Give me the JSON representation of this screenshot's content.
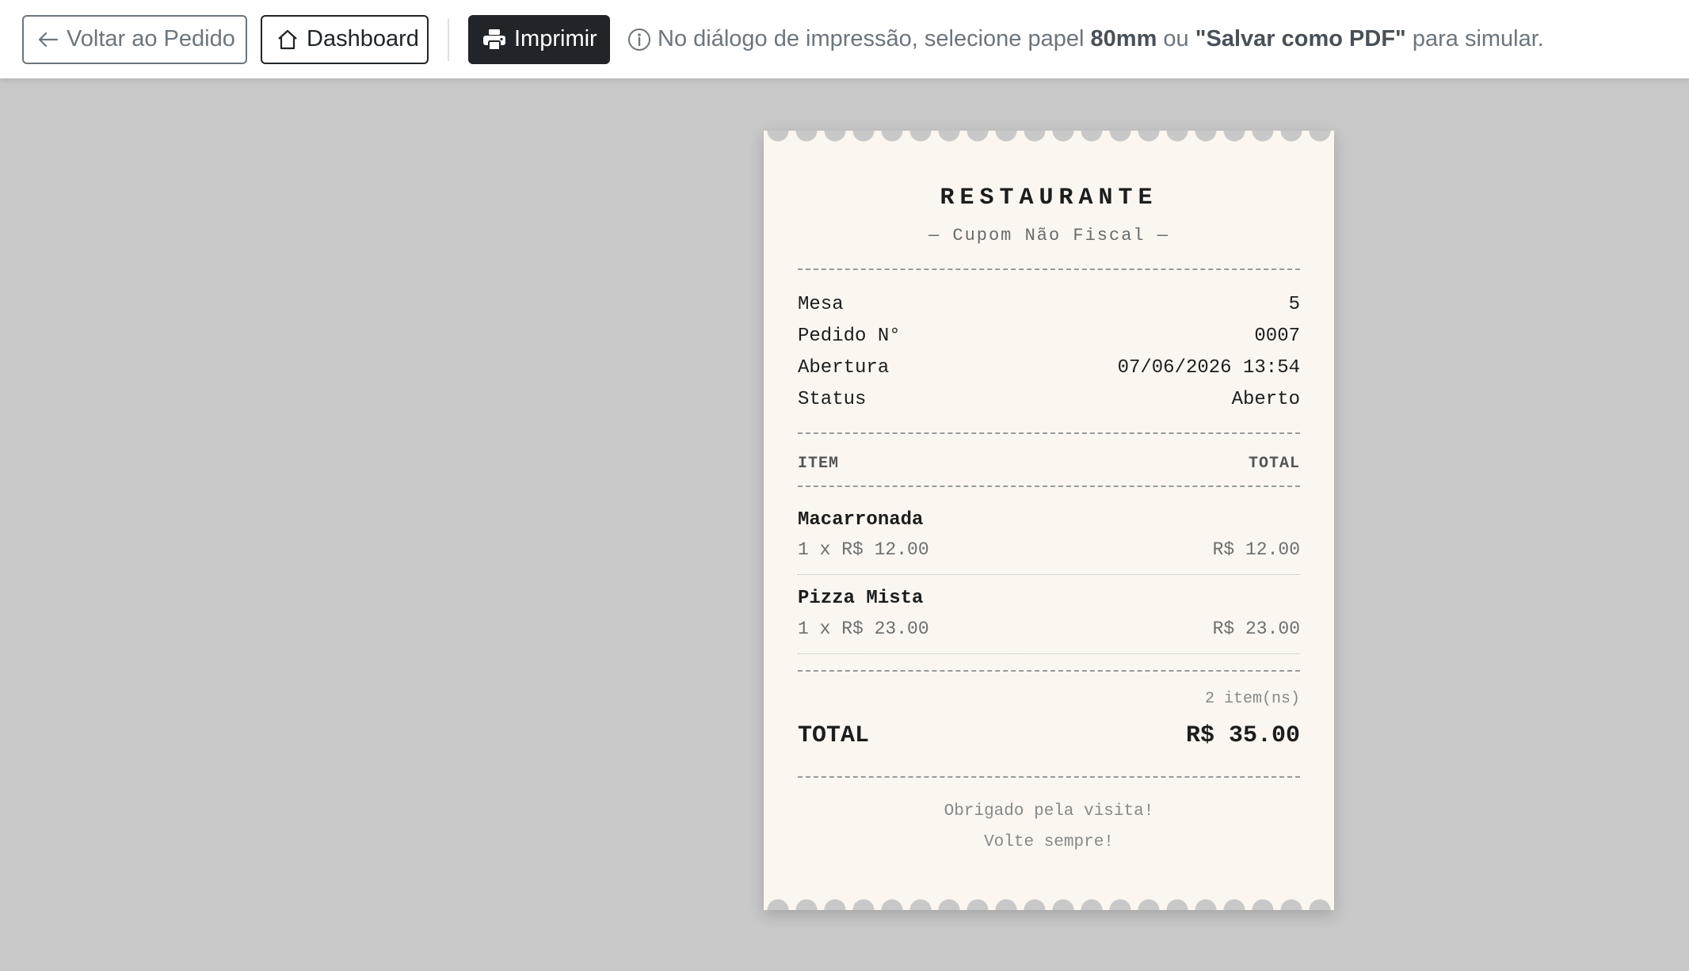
{
  "toolbar": {
    "back_label": "Voltar ao Pedido",
    "dashboard_label": "Dashboard",
    "print_label": "Imprimir",
    "hint_pre": "No diálogo de impressão, selecione papel ",
    "hint_paper": "80mm",
    "hint_mid": " ou ",
    "hint_pdf": "\"Salvar como PDF\"",
    "hint_post": " para simular."
  },
  "receipt": {
    "title": "RESTAURANTE",
    "subtitle": "— Cupom Não Fiscal —",
    "info": {
      "mesa_label": "Mesa",
      "mesa_value": "5",
      "pedido_label": "Pedido N°",
      "pedido_value": "0007",
      "abertura_label": "Abertura",
      "abertura_value": "07/06/2026 13:54",
      "status_label": "Status",
      "status_value": "Aberto"
    },
    "columns": {
      "item": "ITEM",
      "total": "TOTAL"
    },
    "items": [
      {
        "name": "Macarronada",
        "qty_price": "1 x R$ 12.00",
        "total": "R$ 12.00"
      },
      {
        "name": "Pizza Mista",
        "qty_price": "1 x R$ 23.00",
        "total": "R$ 23.00"
      }
    ],
    "item_count": "2 item(ns)",
    "total_label": "TOTAL",
    "total_value": "R$ 35.00",
    "footer": {
      "line1": "Obrigado pela visita!",
      "line2": "Volte sempre!"
    }
  },
  "icons": {
    "back": "arrow-left-icon",
    "dashboard": "house-icon",
    "print": "printer-icon",
    "hint": "info-circle-icon"
  },
  "colors": {
    "page_bg": "#c8c8c8",
    "receipt_bg": "#fbf7f0",
    "print_button_bg": "#212529"
  }
}
